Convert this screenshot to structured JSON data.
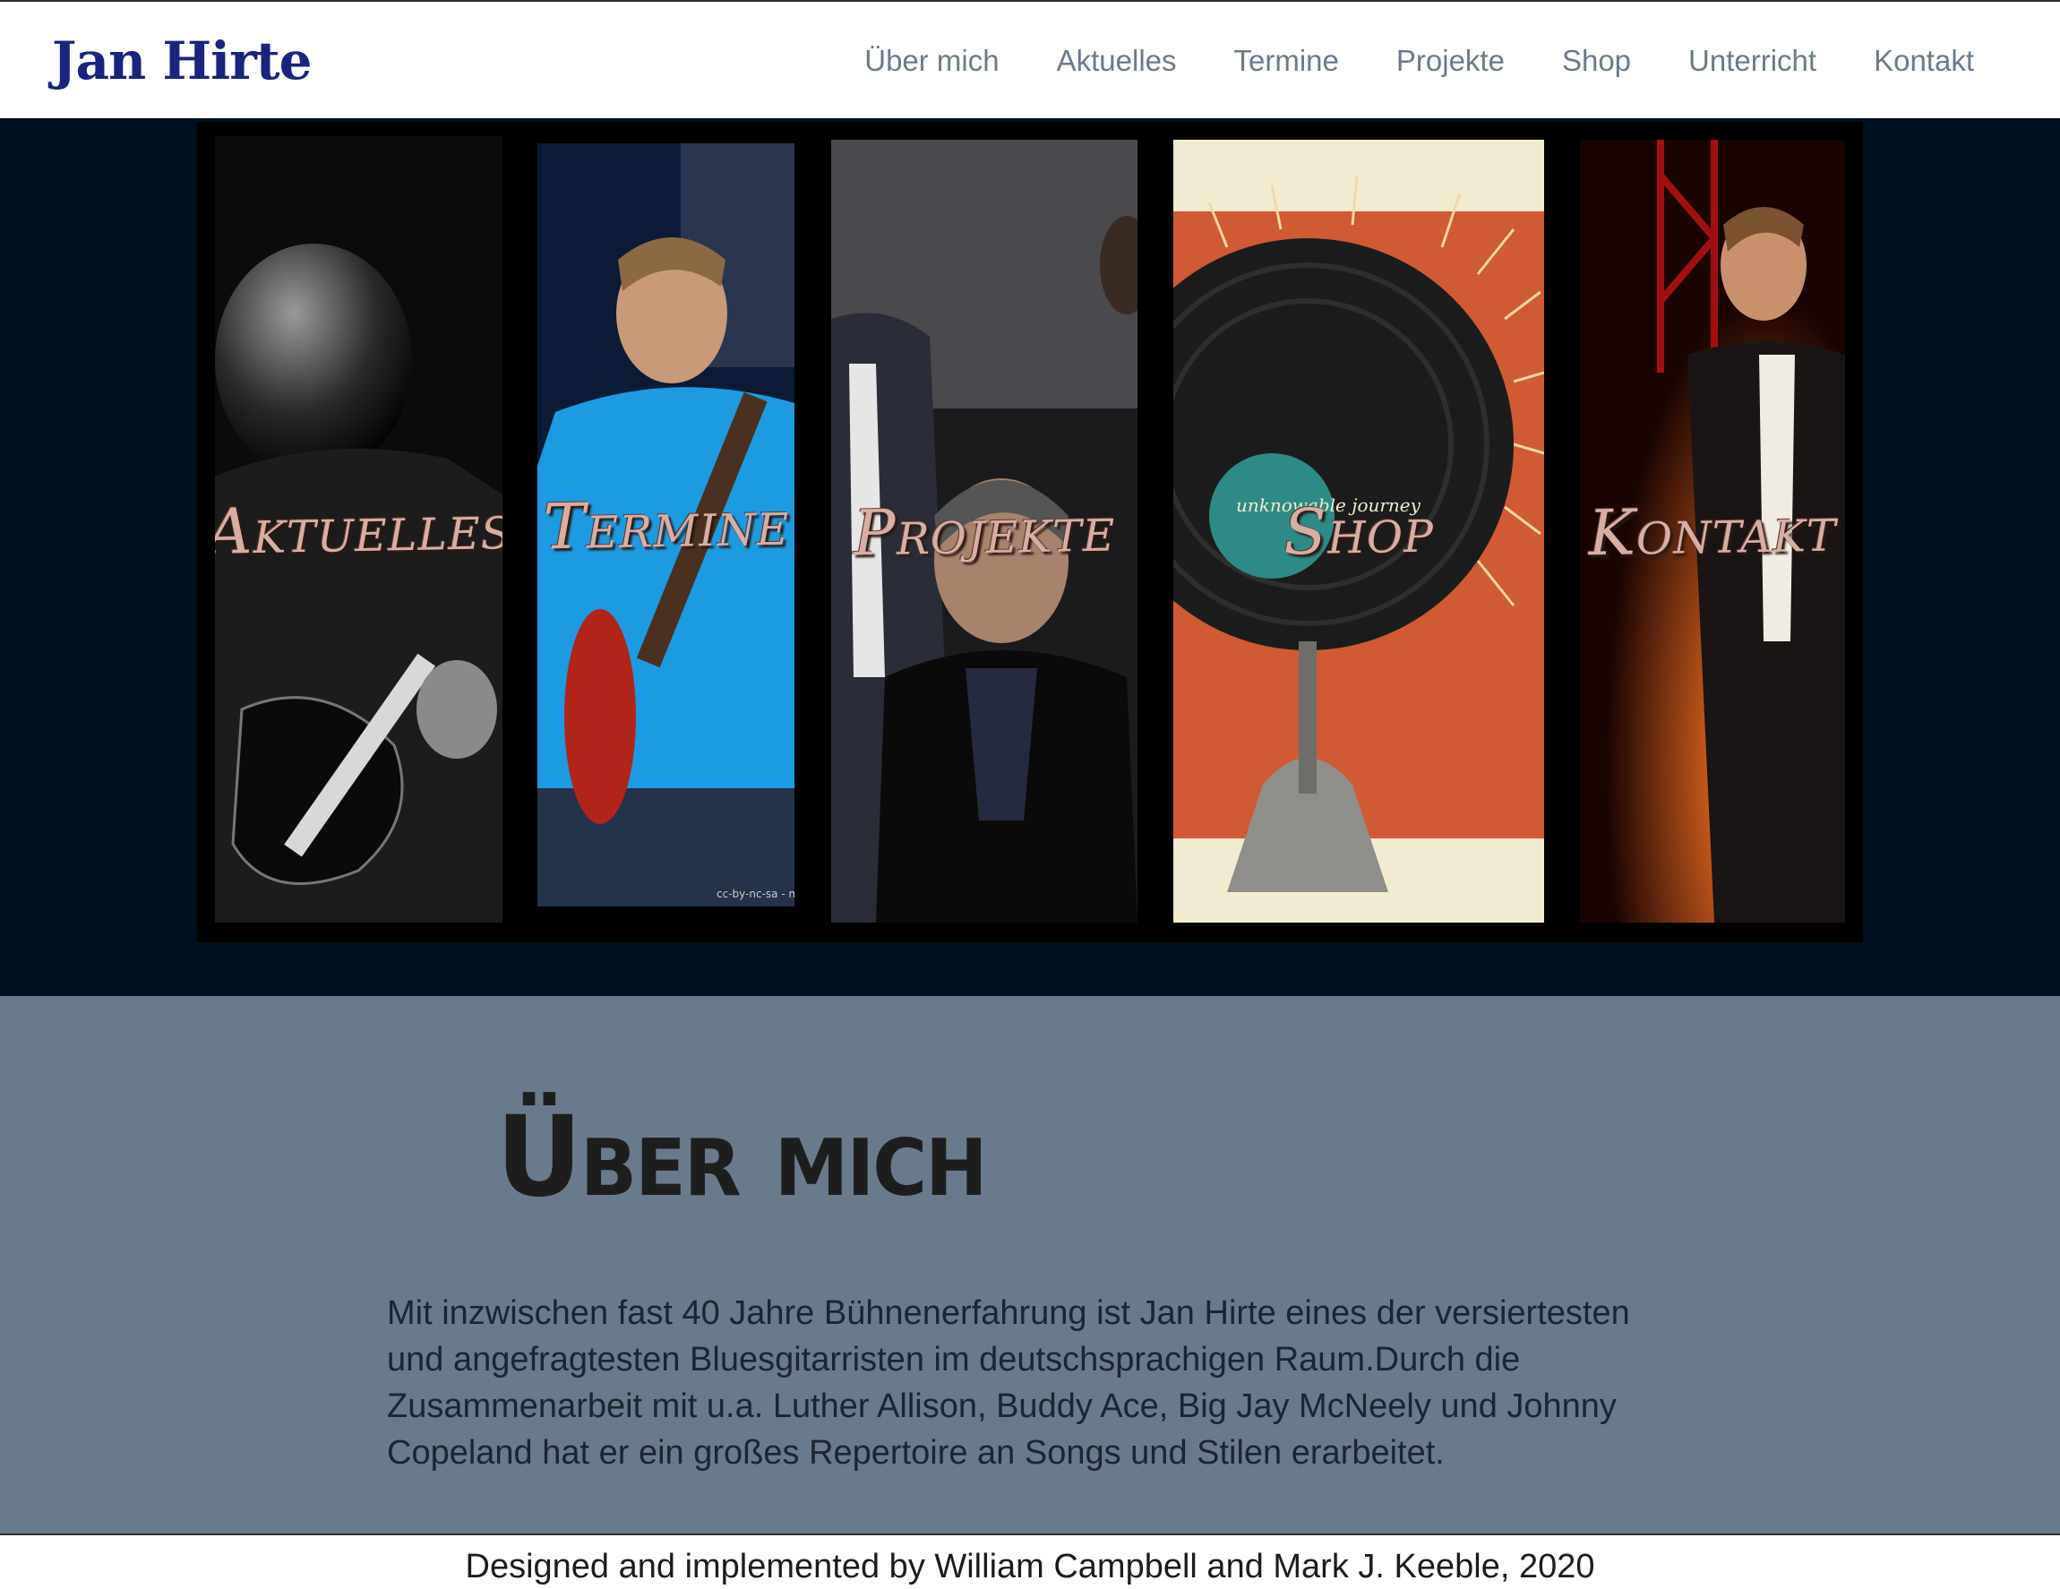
{
  "header": {
    "logo": "Jan Hirte",
    "nav": [
      "Über mich",
      "Aktuelles",
      "Termine",
      "Projekte",
      "Shop",
      "Unterricht",
      "Kontakt"
    ]
  },
  "hero": {
    "tiles": [
      {
        "label": "Aktuelles"
      },
      {
        "label": "Termine",
        "credit": "cc-by-nc-sa - mr"
      },
      {
        "label": "Projekte"
      },
      {
        "label": "Shop",
        "record_label": "unknowable journey"
      },
      {
        "label": "Kontakt"
      }
    ]
  },
  "about": {
    "title": "Über mich",
    "text": "Mit inzwischen fast 40 Jahre Bühnenerfahrung ist Jan Hirte eines der versiertesten und angefragtesten Bluesgitarristen im deutschsprachigen Raum.Durch die Zusammenarbeit mit u.a. Luther Allison, Buddy Ace, Big Jay McNeely und Johnny Copeland hat er ein großes Repertoire an Songs und Stilen erarbeitet."
  },
  "footer": {
    "text": "Designed and implemented by William Campbell and Mark J. Keeble, 2020"
  },
  "colors": {
    "logo": "#1a237e",
    "nav": "#6a7a8c",
    "hero_bg": "#02111f",
    "about_bg": "#697a8c",
    "tile_label": "#d9aea2"
  }
}
